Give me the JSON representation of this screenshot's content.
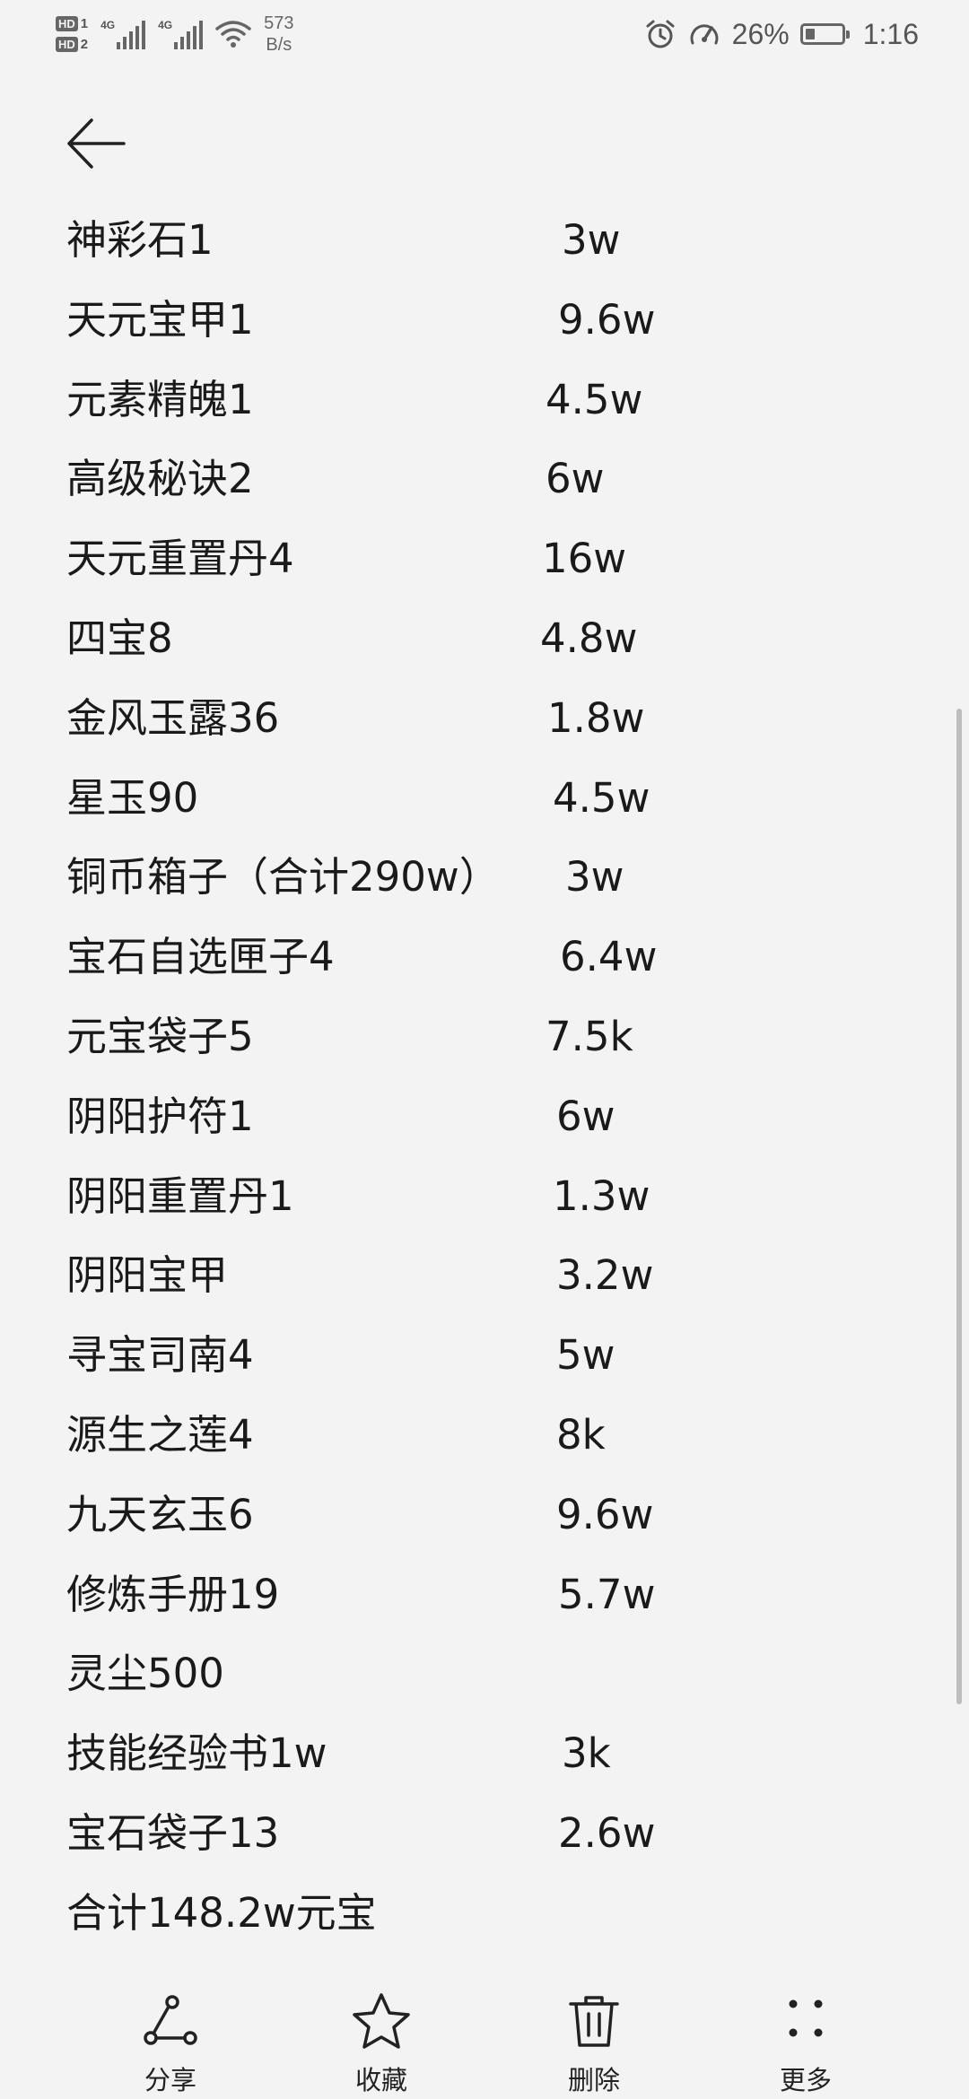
{
  "status_bar": {
    "sim1_label": "HD",
    "sim1_num": "1",
    "sim2_label": "HD",
    "sim2_num": "2",
    "signal1_tech": "4G",
    "signal2_tech": "4G",
    "net_speed_value": "573",
    "net_speed_unit": "B/s",
    "battery_percent": "26%",
    "battery_level": 0.26,
    "time": "1:16",
    "icons": [
      "alarm-icon",
      "speed-icon",
      "battery-icon"
    ]
  },
  "header": {
    "back_icon": "arrow-left-icon"
  },
  "note": {
    "rows": [
      {
        "name": "神彩石1",
        "price": "3w"
      },
      {
        "name": "天元宝甲1",
        "price": "9.6w"
      },
      {
        "name": "元素精魄1",
        "price": "4.5w"
      },
      {
        "name": "高级秘诀2",
        "price": "6w"
      },
      {
        "name": "天元重置丹4",
        "price": "16w"
      },
      {
        "name": "四宝8",
        "price": "4.8w"
      },
      {
        "name": "金风玉露36",
        "price": "1.8w"
      },
      {
        "name": "星玉90",
        "price": "4.5w"
      },
      {
        "name": "铜币箱子（合计290w）",
        "price": "3w"
      },
      {
        "name": "宝石自选匣子4",
        "price": "6.4w"
      },
      {
        "name": "元宝袋子5",
        "price": "7.5k"
      },
      {
        "name": "阴阳护符1",
        "price": "6w"
      },
      {
        "name": "阴阳重置丹1",
        "price": "1.3w"
      },
      {
        "name": "阴阳宝甲",
        "price": "3.2w"
      },
      {
        "name": "寻宝司南4",
        "price": "5w"
      },
      {
        "name": "源生之莲4",
        "price": "8k"
      },
      {
        "name": "九天玄玉6",
        "price": "9.6w"
      },
      {
        "name": "修炼手册19",
        "price": "5.7w"
      },
      {
        "name": "灵尘500",
        "price": ""
      },
      {
        "name": "技能经验书1w",
        "price": "3k"
      },
      {
        "name": "宝石袋子13",
        "price": "2.6w"
      },
      {
        "name": "合计148.2w元宝",
        "price": ""
      }
    ]
  },
  "toolbar": {
    "share_label": "分享",
    "favorite_label": "收藏",
    "delete_label": "删除",
    "more_label": "更多"
  }
}
